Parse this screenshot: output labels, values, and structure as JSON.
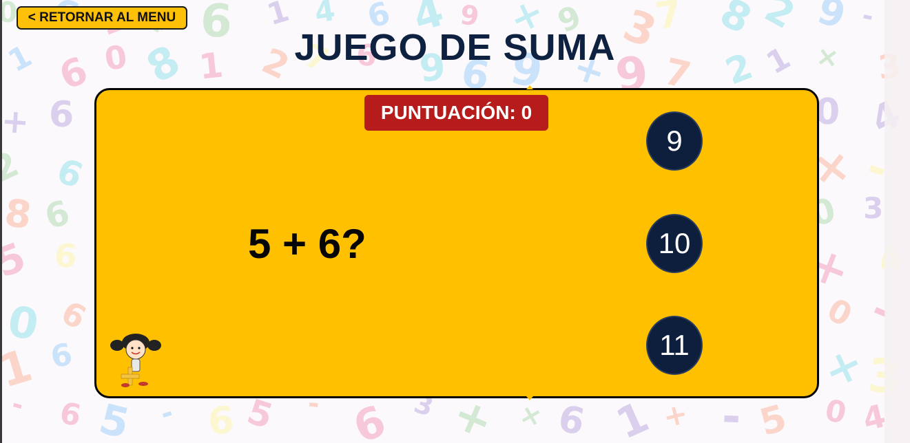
{
  "nav": {
    "back_label": "< RETORNAR AL MENU"
  },
  "game": {
    "title": "JUEGO DE SUMA",
    "score_label": "PUNTUACIÓN: 0",
    "question": "5 + 6?",
    "answers": [
      "9",
      "10",
      "11"
    ]
  },
  "background": {
    "glyphs": [
      "2",
      "6",
      "8",
      "3",
      "5",
      "9",
      "0",
      "4",
      "1",
      "7",
      "+",
      "-",
      "×"
    ],
    "colors": [
      "#f48fb1",
      "#b39ddb",
      "#80deea",
      "#a5d6a7",
      "#fff59d",
      "#ffab91",
      "#90caf9"
    ]
  },
  "colors": {
    "board": "#ffc000",
    "score_badge": "#b71c1c",
    "answer_circle": "#0d1f3c",
    "title": "#0f2140"
  },
  "icons": {
    "mascot": "girl-with-plus-sign-icon"
  }
}
